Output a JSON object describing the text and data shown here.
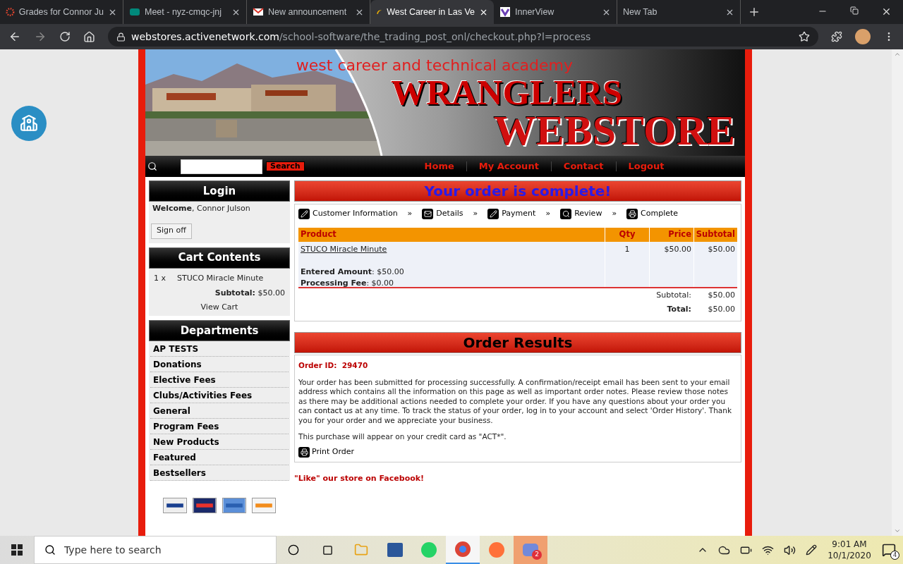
{
  "browser": {
    "tabs": [
      {
        "title": "Grades for Connor Ju",
        "selected": false
      },
      {
        "title": "Meet - nyz-cmqc-jnj",
        "selected": false
      },
      {
        "title": "New announcement",
        "selected": false
      },
      {
        "title": "West Career in Las Ve",
        "selected": true
      },
      {
        "title": "InnerView",
        "selected": false
      },
      {
        "title": "New Tab",
        "selected": false
      }
    ],
    "url_host": "webstores.activenetwork.com",
    "url_path": "/school-software/the_trading_post_onl/checkout.php?l=process"
  },
  "banner": {
    "school": "west career and technical academy",
    "title_1": "WRANGLERS",
    "title_2": "WEBSTORE"
  },
  "nav": {
    "search_button": "Search",
    "links": [
      "Home",
      "My Account",
      "Contact",
      "Logout"
    ]
  },
  "login": {
    "title": "Login",
    "welcome": "**Welcome**, Connor Julson",
    "button": "Sign off"
  },
  "cart": {
    "title": "Cart Contents",
    "items": [
      {
        "qty": "1 x",
        "name": "STUCO Miracle Minute"
      }
    ],
    "subtotal": "**Subtotal:** $50.00",
    "view": "View Cart"
  },
  "departments": {
    "title": "Departments",
    "items": [
      "AP TESTS",
      "Donations",
      "Elective Fees",
      "Clubs/Activities Fees",
      "General",
      "Program Fees",
      "New Products",
      "Featured",
      "Bestsellers"
    ]
  },
  "order": {
    "heading": "Your order is complete!",
    "steps": [
      {
        "label": "Customer Information",
        "after": "»"
      },
      {
        "label": "Details",
        "after": "»"
      },
      {
        "label": "Payment",
        "after": "»"
      },
      {
        "label": "Review",
        "after": "»"
      },
      {
        "label": "Complete"
      }
    ],
    "columns": [
      "Product",
      "Qty",
      "Price",
      "Subtotal"
    ],
    "rows": [
      {
        "product": "STUCO Miracle Minute",
        "qty": "1",
        "price": "$50.00",
        "subtotal": "$50.00",
        "details": [
          "**Entered Amount**: $50.00",
          "**Processing Fee**: $0.00"
        ]
      }
    ],
    "totals": [
      {
        "label": "Subtotal:",
        "value": "$50.00",
        "bold": false
      },
      {
        "label": "Total:",
        "value": "$50.00",
        "bold": true
      }
    ]
  },
  "results": {
    "title": "Order Results",
    "order_id": "Order ID:  29470",
    "text_before": "Your order has been submitted for processing successfully. A confirmation/receipt email has been sent to your email address which contains all the information on this page as well as important order notes. Please review those notes as there may be additional actions needed to complete your order. If you have any questions about your order you can ",
    "link": "contact us",
    "text_after": " at any time. To track the status of your order, log in to your account and select 'Order History'. Thank you for your order and we appreciate your business.",
    "credit": "This purchase will appear on your credit card as \"ACT*\".",
    "print": "Print Order"
  },
  "facebook": "\"Like\" our store on Facebook!",
  "taskbar": {
    "search_placeholder": "Type here to search",
    "time": "9:01 AM",
    "date": "10/1/2020",
    "app_badge": "2",
    "notification_count": "4"
  }
}
